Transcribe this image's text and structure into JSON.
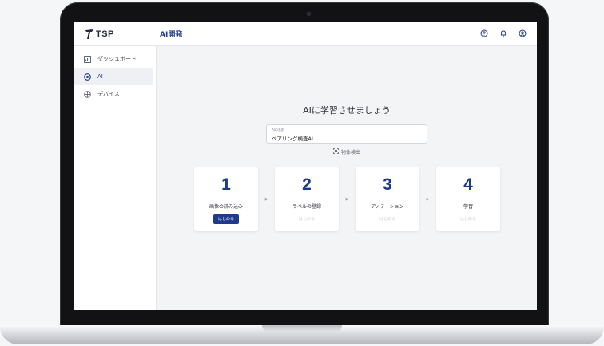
{
  "app": {
    "logo_text": "TSP",
    "page_title": "AI開発"
  },
  "topbar": {
    "icons": [
      "help-icon",
      "bell-icon",
      "account-icon"
    ]
  },
  "sidebar": {
    "items": [
      {
        "label": "ダッシュボード",
        "icon": "dashboard-icon",
        "active": false
      },
      {
        "label": "AI",
        "icon": "ai-icon",
        "active": true
      },
      {
        "label": "デバイス",
        "icon": "device-icon",
        "active": false
      }
    ]
  },
  "main": {
    "heading": "AIに学習させましょう",
    "name_field": {
      "label": "AIの名前",
      "value": "ベアリング検査AI"
    },
    "detection_type": "物体検出",
    "steps": [
      {
        "number": "1",
        "label": "画像の読み込み",
        "button": "はじめる",
        "enabled": true
      },
      {
        "number": "2",
        "label": "ラベルの登録",
        "button": "はじめる",
        "enabled": false
      },
      {
        "number": "3",
        "label": "アノテーション",
        "button": "はじめる",
        "enabled": false
      },
      {
        "number": "4",
        "label": "学習",
        "button": "はじめる",
        "enabled": false
      }
    ]
  },
  "colors": {
    "accent": "#1e3a8a",
    "background": "#f3f4f6",
    "laptop_frame": "#121214"
  }
}
